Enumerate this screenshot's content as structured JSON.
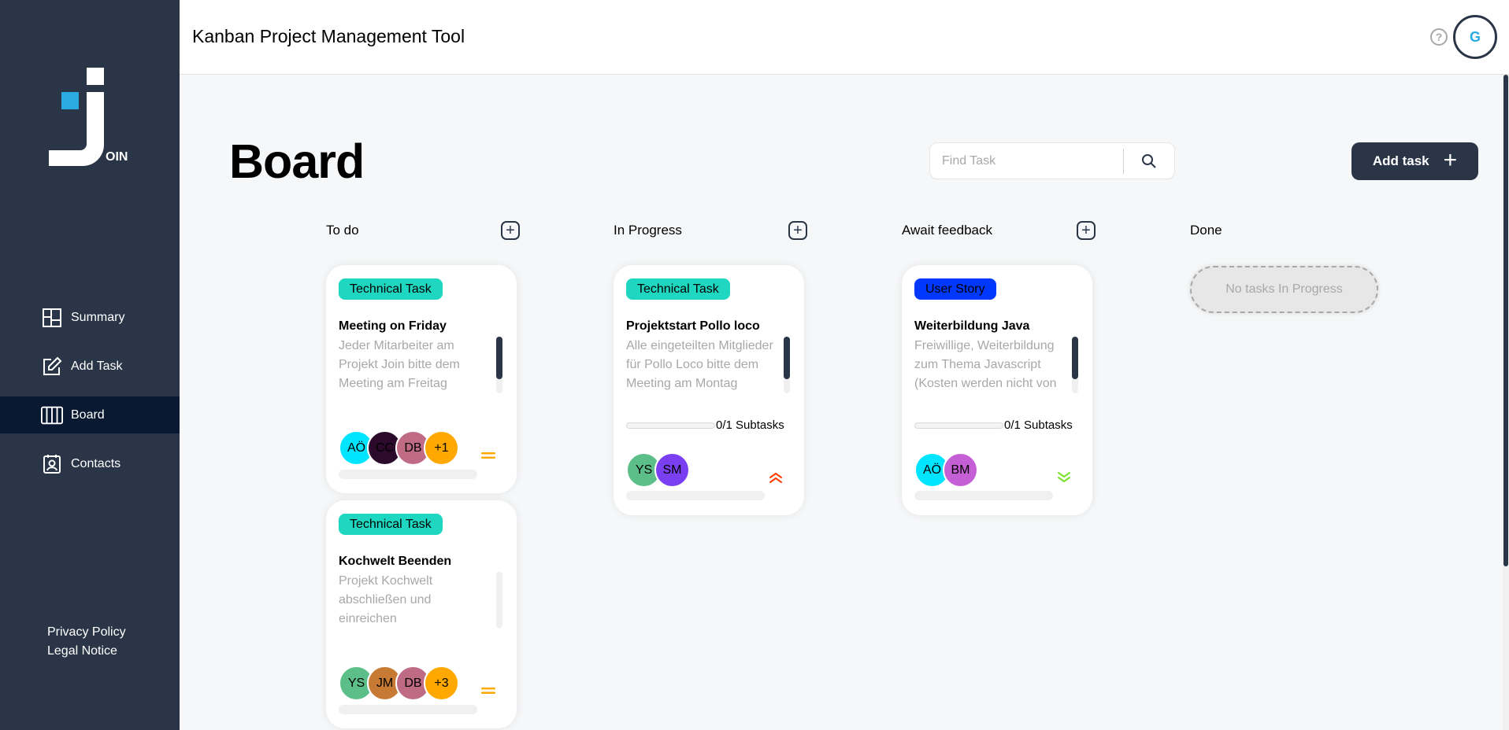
{
  "app": {
    "logo_text": "OIN",
    "header_title": "Kanban Project Management Tool",
    "help_symbol": "?",
    "user_initial": "G"
  },
  "sidebar": {
    "items": [
      {
        "label": "Summary",
        "icon": "summary-icon",
        "active": false
      },
      {
        "label": "Add Task",
        "icon": "edit-icon",
        "active": false
      },
      {
        "label": "Board",
        "icon": "board-icon",
        "active": true
      },
      {
        "label": "Contacts",
        "icon": "contacts-icon",
        "active": false
      }
    ],
    "footer": {
      "privacy": "Privacy Policy",
      "legal": "Legal Notice"
    }
  },
  "board": {
    "title": "Board",
    "search_placeholder": "Find Task",
    "add_task_label": "Add task",
    "add_task_plus": "+"
  },
  "columns": [
    {
      "title": "To do",
      "add": "+"
    },
    {
      "title": "In Progress",
      "add": "+"
    },
    {
      "title": "Await feedback",
      "add": "+"
    },
    {
      "title": "Done",
      "empty_text": "No tasks In Progress"
    }
  ],
  "cards": {
    "todo_1": {
      "category": "Technical Task",
      "title": "Meeting on Friday",
      "description": "Jeder Mitarbeiter am Projekt Join bitte dem Meeting am Freitag",
      "assignees": [
        {
          "initials": "AÖ",
          "color": "#00e5ff"
        },
        {
          "initials": "CC",
          "color": "#2b0a2b"
        },
        {
          "initials": "DB",
          "color": "#c06b86"
        },
        {
          "initials": "+1",
          "color": "#ffa800"
        }
      ],
      "priority": "medium",
      "priority_color": "#ffa800"
    },
    "todo_2": {
      "category": "Technical Task",
      "title": "Kochwelt Beenden",
      "description": "Projekt Kochwelt abschließen und einreichen",
      "assignees": [
        {
          "initials": "YS",
          "color": "#5cbf8a"
        },
        {
          "initials": "JM",
          "color": "#c77a34"
        },
        {
          "initials": "DB",
          "color": "#c06b86"
        },
        {
          "initials": "+3",
          "color": "#ffa800"
        }
      ],
      "priority": "medium",
      "priority_color": "#ffa800"
    },
    "progress_1": {
      "category": "Technical Task",
      "title": "Projektstart Pollo loco",
      "description": "Alle eingeteilten Mitglieder für Pollo Loco bitte dem Meeting am Montag",
      "subtasks": "0/1 Subtasks",
      "subtasks_done": 0,
      "subtasks_total": 1,
      "assignees": [
        {
          "initials": "YS",
          "color": "#5cbf8a"
        },
        {
          "initials": "SM",
          "color": "#7b3ff2"
        }
      ],
      "priority": "urgent",
      "priority_color": "#ff3d00"
    },
    "feedback_1": {
      "category": "User Story",
      "title": "Weiterbildung Java",
      "description": "Freiwillige, Weiterbildung zum Thema Javascript (Kosten werden nicht von",
      "subtasks": "0/1 Subtasks",
      "subtasks_done": 0,
      "subtasks_total": 1,
      "assignees": [
        {
          "initials": "AÖ",
          "color": "#00e5ff"
        },
        {
          "initials": "BM",
          "color": "#c55fd6"
        }
      ],
      "priority": "low",
      "priority_color": "#7ae229"
    }
  },
  "colors": {
    "sidebar": "#2a3647",
    "sidebar_active": "#091931",
    "accent": "#29abe2",
    "technical_task": "#1fd7c1",
    "user_story": "#0038ff"
  }
}
